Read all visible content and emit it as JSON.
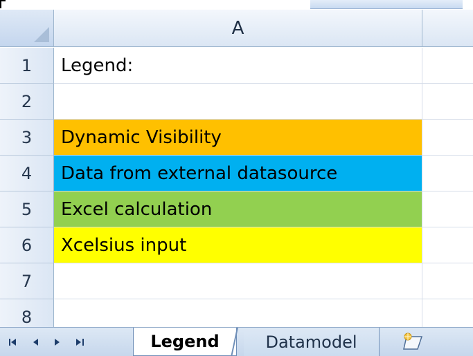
{
  "sheet": {
    "columns": [
      "A"
    ],
    "rows": [
      {
        "number": "1",
        "value": "Legend:",
        "fill": ""
      },
      {
        "number": "2",
        "value": "",
        "fill": ""
      },
      {
        "number": "3",
        "value": "Dynamic Visibility",
        "fill": "#ffc000"
      },
      {
        "number": "4",
        "value": "Data from external datasource",
        "fill": "#00b0f0"
      },
      {
        "number": "5",
        "value": "Excel calculation",
        "fill": "#92d050"
      },
      {
        "number": "6",
        "value": "Xcelsius input",
        "fill": "#ffff00"
      },
      {
        "number": "7",
        "value": "",
        "fill": ""
      },
      {
        "number": "8",
        "value": "",
        "fill": ""
      }
    ]
  },
  "tabs": {
    "nav": {
      "first": "first-sheet-icon",
      "prev": "prev-sheet-icon",
      "next": "next-sheet-icon",
      "last": "last-sheet-icon"
    },
    "items": [
      {
        "label": "Legend",
        "active": true
      },
      {
        "label": "Datamodel",
        "active": false
      }
    ],
    "new_sheet_icon": "insert-worksheet-icon"
  }
}
